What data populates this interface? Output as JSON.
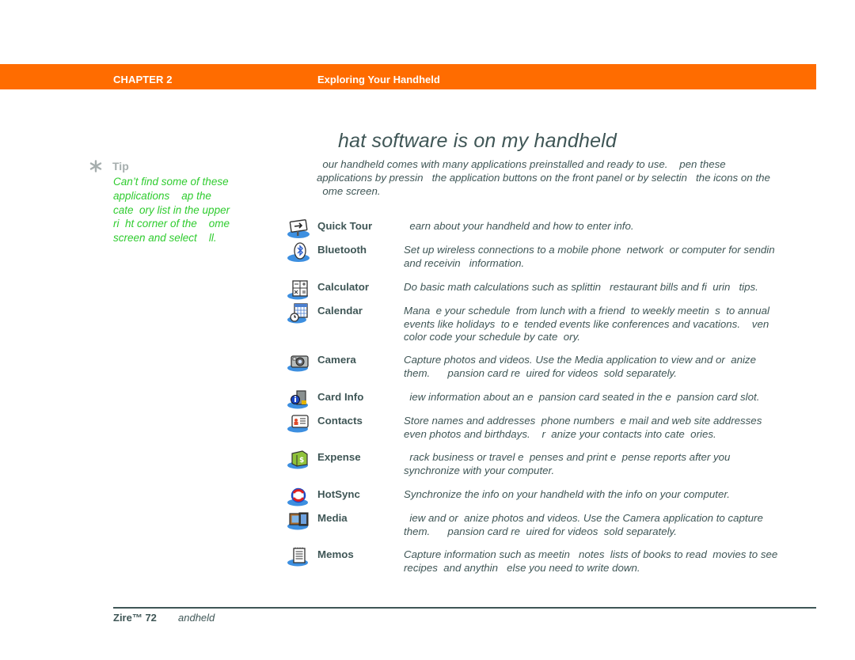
{
  "header": {
    "chapter": "CHAPTER 2",
    "title": "Exploring Your Handheld",
    "accent_color": "#ff6c00"
  },
  "tip": {
    "icon": "asterisk-icon",
    "label": "Tip",
    "text": "Can’t find some of these\napplications    ap the\ncate  ory list in the upper\nri  ht corner of the    ome\nscreen and select    ll.",
    "text_color": "#2fcc2f"
  },
  "page": {
    "heading": "hat software is on my handheld",
    "intro": "  our handheld comes with many applications preinstalled and ready to use.    pen these\napplications by pressin   the application buttons on the front panel or by selectin   the icons on the\n  ome screen."
  },
  "apps": [
    {
      "icon": "quick-tour-icon",
      "name": "Quick Tour",
      "description": "  earn about your handheld and how to enter info."
    },
    {
      "icon": "bluetooth-icon",
      "name": "Bluetooth",
      "description": "Set up wireless connections to a mobile phone  network  or computer for sendin\nand receivin   information."
    },
    {
      "icon": "calculator-icon",
      "name": "Calculator",
      "description": "Do basic math calculations such as splittin   restaurant bills and fi  urin   tips."
    },
    {
      "icon": "calendar-icon",
      "name": "Calendar",
      "description": "Mana  e your schedule  from lunch with a friend  to weekly meetin  s  to annual\nevents like holidays  to e  tended events like conferences and vacations.    ven\ncolor code your schedule by cate  ory."
    },
    {
      "icon": "camera-icon",
      "name": "Camera",
      "description": "Capture photos and videos. Use the Media application to view and or  anize\nthem.      pansion card re  uired for videos  sold separately."
    },
    {
      "icon": "card-info-icon",
      "name": "Card Info",
      "description": "  iew information about an e  pansion card seated in the e  pansion card slot."
    },
    {
      "icon": "contacts-icon",
      "name": "Contacts",
      "description": "Store names and addresses  phone numbers  e mail and web site addresses\neven photos and birthdays.    r  anize your contacts into cate  ories."
    },
    {
      "icon": "expense-icon",
      "name": "Expense",
      "description": "  rack business or travel e  penses and print e  pense reports after you\nsynchronize with your computer."
    },
    {
      "icon": "hotsync-icon",
      "name": "HotSync",
      "description": "Synchronize the info on your handheld with the info on your computer."
    },
    {
      "icon": "media-icon",
      "name": "Media",
      "description": "  iew and or  anize photos and videos. Use the Camera application to capture\nthem.      pansion card re  uired for videos  sold separately."
    },
    {
      "icon": "memos-icon",
      "name": "Memos",
      "description": "Capture information such as meetin   notes  lists of books to read  movies to see\nrecipes  and anythin   else you need to write down."
    }
  ],
  "footer": {
    "product": "Zire™ 72",
    "product_suffix": "andheld"
  }
}
